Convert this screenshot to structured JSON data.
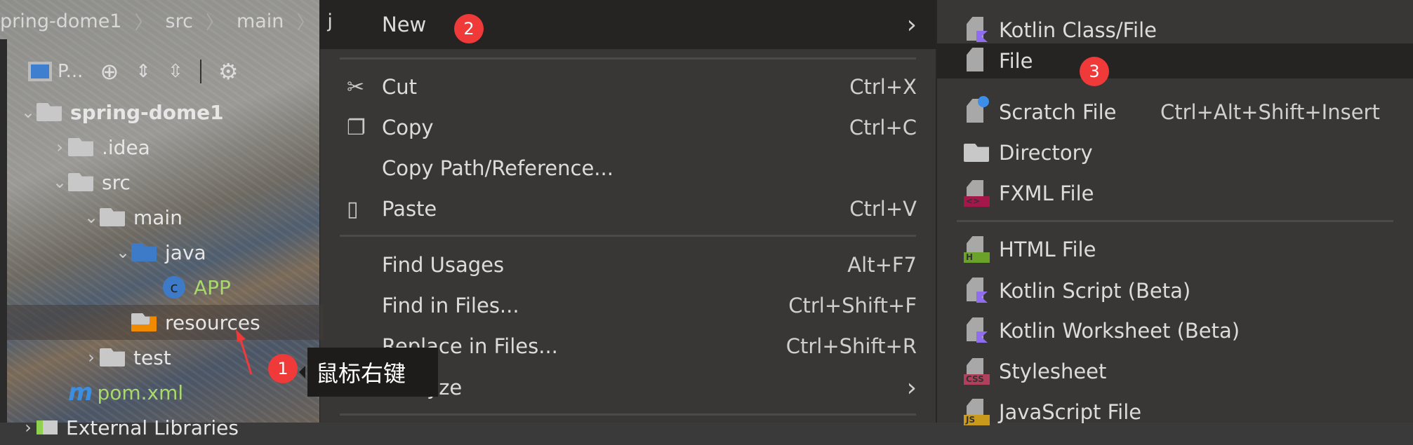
{
  "breadcrumb": [
    "pring-dome1",
    "src",
    "main",
    "j"
  ],
  "toolbar": {
    "project_label": "P..."
  },
  "tree": [
    {
      "label": "spring-dome1",
      "chev": "⌄",
      "indent": 0,
      "icon": "module-folder-icon"
    },
    {
      "label": ".idea",
      "chev": "›",
      "indent": 1,
      "icon": "folder-icon"
    },
    {
      "label": "src",
      "chev": "⌄",
      "indent": 1,
      "icon": "folder-icon"
    },
    {
      "label": "main",
      "chev": "⌄",
      "indent": 2,
      "icon": "folder-icon"
    },
    {
      "label": "java",
      "chev": "⌄",
      "indent": 3,
      "icon": "source-folder-icon"
    },
    {
      "label": "APP",
      "chev": "",
      "indent": 4,
      "icon": "java-class-icon"
    },
    {
      "label": "resources",
      "chev": "",
      "indent": 3,
      "icon": "resources-folder-icon",
      "selected": true
    },
    {
      "label": "test",
      "chev": "›",
      "indent": 2,
      "icon": "folder-icon"
    },
    {
      "label": "pom.xml",
      "chev": "",
      "indent": 1,
      "icon": "maven-icon"
    },
    {
      "label": "External Libraries",
      "chev": "›",
      "indent": 0,
      "icon": "libraries-icon"
    }
  ],
  "annotations": {
    "step1": "1",
    "step2": "2",
    "step3": "3",
    "tooltip": "鼠标右键"
  },
  "context_menu": [
    {
      "label": "New",
      "shortcut": "",
      "submenu": true,
      "highlighted": true
    },
    {
      "label": "Cut",
      "shortcut": "Ctrl+X",
      "icon": "scissors-icon"
    },
    {
      "label": "Copy",
      "shortcut": "Ctrl+C",
      "icon": "copy-icon"
    },
    {
      "label": "Copy Path/Reference...",
      "shortcut": ""
    },
    {
      "label": "Paste",
      "shortcut": "Ctrl+V",
      "icon": "clipboard-icon"
    },
    {
      "label": "Find Usages",
      "shortcut": "Alt+F7"
    },
    {
      "label": "Find in Files...",
      "shortcut": "Ctrl+Shift+F"
    },
    {
      "label": "Replace in Files...",
      "shortcut": "Ctrl+Shift+R"
    },
    {
      "label": "Analyze",
      "shortcut": "",
      "submenu": true
    }
  ],
  "new_submenu": [
    {
      "label": "Kotlin Class/File",
      "shortcut": "",
      "icon": "kotlin-file-icon"
    },
    {
      "label": "File",
      "shortcut": "",
      "icon": "file-icon",
      "highlighted": true
    },
    {
      "label": "Scratch File",
      "shortcut": "Ctrl+Alt+Shift+Insert",
      "icon": "scratch-file-icon"
    },
    {
      "label": "Directory",
      "shortcut": "",
      "icon": "directory-icon"
    },
    {
      "label": "FXML File",
      "shortcut": "",
      "icon": "fxml-file-icon",
      "tag": "<>"
    },
    {
      "label": "HTML File",
      "shortcut": "",
      "icon": "html-file-icon",
      "tag": "H"
    },
    {
      "label": "Kotlin Script (Beta)",
      "shortcut": "",
      "icon": "kotlin-script-icon"
    },
    {
      "label": "Kotlin Worksheet (Beta)",
      "shortcut": "",
      "icon": "kotlin-worksheet-icon"
    },
    {
      "label": "Stylesheet",
      "shortcut": "",
      "icon": "css-file-icon",
      "tag": "CSS"
    },
    {
      "label": "JavaScript File",
      "shortcut": "",
      "icon": "js-file-icon",
      "tag": "JS"
    }
  ],
  "colors": {
    "menu_bg": "#383736",
    "highlight": "#252423",
    "badge": "#f03a3a",
    "kotlin": "#8f6cf0",
    "fxml": "#a3174a",
    "html": "#6aa22a",
    "css": "#b0405c",
    "js": "#c99a1c",
    "green_text": "#a9d96c"
  }
}
